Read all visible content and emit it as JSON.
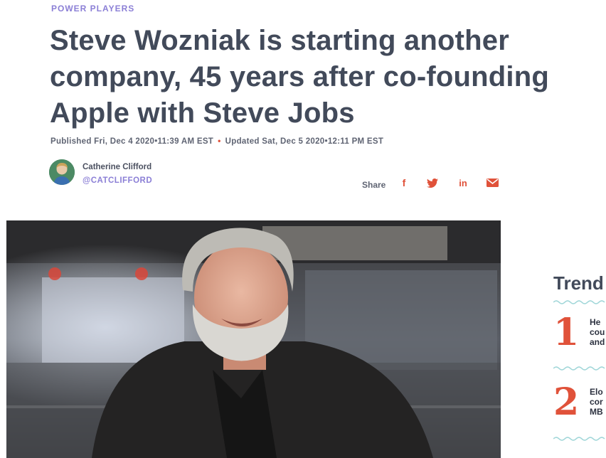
{
  "article": {
    "kicker": "POWER PLAYERS",
    "headline": "Steve Wozniak is starting another company, 45 years after co-founding Apple with Steve Jobs",
    "published": "Published Fri, Dec 4 2020•11:39 AM EST",
    "separator": "•",
    "updated": "Updated Sat, Dec 5 2020•12:11 PM EST"
  },
  "author": {
    "name": "Catherine Clifford",
    "handle": "@CATCLIFFORD"
  },
  "share": {
    "label": "Share",
    "icons": [
      "facebook-icon",
      "twitter-icon",
      "linkedin-icon",
      "email-icon"
    ],
    "facebook_glyph": "f",
    "linkedin_glyph": "in"
  },
  "trending": {
    "title": "Trend",
    "items": [
      {
        "rank": "1",
        "lines": [
          "He",
          "cou",
          "and"
        ]
      },
      {
        "rank": "2",
        "lines": [
          "Elo",
          "cor",
          "MB"
        ]
      }
    ]
  },
  "colors": {
    "accent": "#e0523a",
    "kicker": "#8b7fd6",
    "headline": "#424a5a",
    "wave": "#9fd6d8"
  }
}
